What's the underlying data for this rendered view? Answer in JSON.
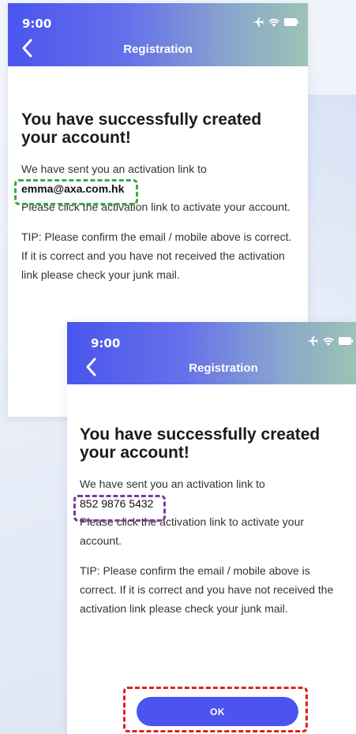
{
  "screens": [
    {
      "status_time": "9:00",
      "nav_title": "Registration",
      "headline": "You have successfully created your account!",
      "sent_text": "We have sent you an activation link to",
      "contact": "emma@axa.com.hk",
      "click_text": "Please click the activation link to activate your account.",
      "tip_text": "TIP: Please confirm the email / mobile above is correct. If it is correct and you have not received the activation link please check your junk mail."
    },
    {
      "status_time": "9:00",
      "nav_title": "Registration",
      "headline": "You have successfully created your account!",
      "sent_text": "We have sent you an activation link to",
      "contact": "852 9876 5432",
      "click_text": "Please click the activation link to activate your account.",
      "tip_text": "TIP: Please confirm the email / mobile above is correct. If it is correct and you have not received the activation link please check your junk mail.",
      "ok_label": "OK"
    }
  ],
  "icons": [
    "airplane-icon",
    "wifi-icon",
    "battery-icon",
    "back-chevron-icon"
  ],
  "colors": {
    "header_start": "#4a55ee",
    "header_end": "#9cc3b5",
    "ok_button": "#4b54ee",
    "highlight_email": "#3ea845",
    "highlight_mobile": "#7a3c9a",
    "highlight_button": "#e02020"
  }
}
